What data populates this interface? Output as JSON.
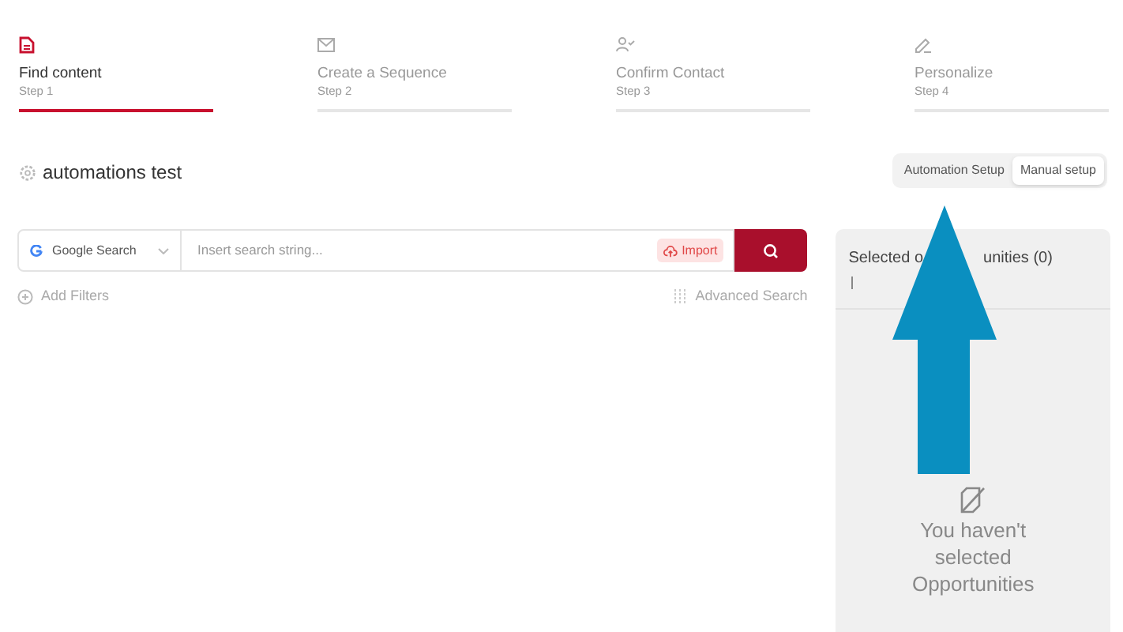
{
  "steps": [
    {
      "title": "Find content",
      "subtitle": "Step 1",
      "selected": true,
      "kind": "doc"
    },
    {
      "title": "Create a Sequence",
      "subtitle": "Step 2",
      "selected": false,
      "kind": "mail"
    },
    {
      "title": "Confirm Contact",
      "subtitle": "Step 3",
      "selected": false,
      "kind": "user"
    },
    {
      "title": "Personalize",
      "subtitle": "Step 4",
      "selected": false,
      "kind": "pen"
    }
  ],
  "campaign": {
    "title": "automations test"
  },
  "mode_toggle": [
    {
      "label": "Automation Setup",
      "selected": false
    },
    {
      "label": "Manual setup",
      "selected": true
    }
  ],
  "search": {
    "source": "Google Search",
    "placeholder": "Insert search string...",
    "import_label": "Import"
  },
  "add_filters": "Add Filters",
  "advanced_search": "Advanced Search",
  "selected_panel": {
    "heading_left": "Selected o",
    "heading_right": "unities (0)",
    "empty_lines": [
      "You haven't",
      "selected",
      "Opportunities"
    ]
  }
}
